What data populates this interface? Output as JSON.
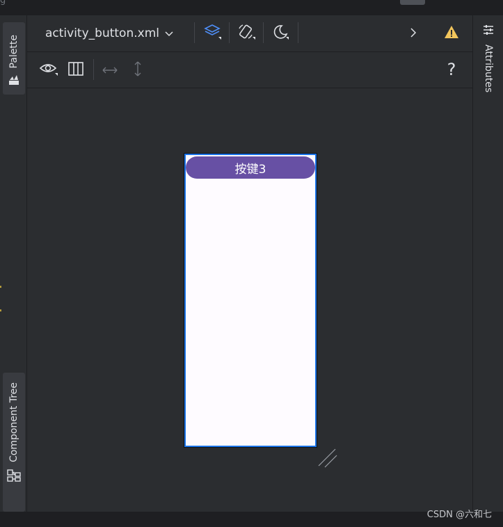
{
  "topbar": {
    "partial_title": "g"
  },
  "left_panel": {
    "palette_label": "Palette",
    "component_tree_label": "Component Tree"
  },
  "right_panel": {
    "attributes_label": "Attributes"
  },
  "toolbar": {
    "file_name": "activity_button.xml",
    "help_label": "?"
  },
  "device_preview": {
    "button_text": "按键3"
  },
  "colors": {
    "accent_blue": "#4e8ef7",
    "warning": "#f2c55c",
    "button_purple": "#6750a4",
    "device_bg": "#fefbff",
    "selection": "#1a73e8"
  },
  "watermark": "CSDN @六和七"
}
